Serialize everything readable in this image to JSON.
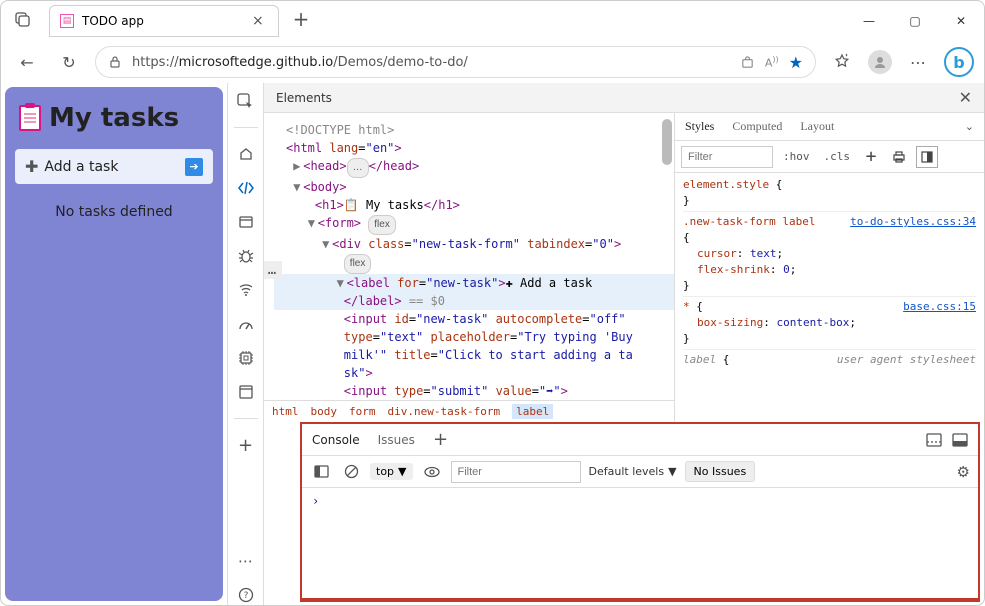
{
  "tab": {
    "title": "TODO app"
  },
  "url": {
    "lock": "🔒",
    "host": "microsoftedge.github.io",
    "path": "/Demos/demo-to-do/",
    "prefix": "https://"
  },
  "app": {
    "title": "My tasks",
    "add_label": "Add a task",
    "empty_label": "No tasks defined"
  },
  "devtools": {
    "main_tab": "Elements",
    "tree": {
      "doctype": "<!DOCTYPE html>",
      "html_open": "<html lang=\"en\">",
      "head_open": "<head>",
      "head_dots": "…",
      "head_close": "</head>",
      "body_open": "<body>",
      "h1_line": "<h1>📋 My tasks</h1>",
      "form_open": "<form>",
      "flex_badge": "flex",
      "div_open": "<div class=\"new-task-form\" tabindex=\"0\">",
      "label_open": "<label for=\"new-task\">",
      "label_text": "✚ Add a task",
      "label_close": "</label>",
      "label_tail": " == $0",
      "input_new": "<input id=\"new-task\" autocomplete=\"off\" type=\"text\" placeholder=\"Try typing 'Buy milk'\" title=\"Click to start adding a task\">",
      "input_submit": "<input type=\"submit\" value=\"➡\">"
    },
    "breadcrumb": [
      "html",
      "body",
      "form",
      "div.new-task-form",
      "label"
    ],
    "styles": {
      "tabs": [
        "Styles",
        "Computed",
        "Layout"
      ],
      "filter_placeholder": "Filter",
      "hov": ":hov",
      "cls": ".cls",
      "rules": [
        {
          "selector": "element.style {",
          "body": [],
          "close": "}"
        },
        {
          "selector": ".new-task-form label {",
          "src": "to-do-styles.css:34",
          "body": [
            [
              "cursor",
              "text"
            ],
            [
              "flex-shrink",
              "0"
            ]
          ],
          "close": "}"
        },
        {
          "selector": "* {",
          "src": "base.css:15",
          "body": [
            [
              "box-sizing",
              "content-box"
            ]
          ],
          "close": "}"
        },
        {
          "selector": "label {",
          "ua": "user agent stylesheet"
        }
      ]
    },
    "drawer": {
      "tabs": [
        "Console",
        "Issues"
      ],
      "context": "top",
      "filter_placeholder": "Filter",
      "levels": "Default levels",
      "no_issues": "No Issues",
      "prompt": "›"
    }
  }
}
